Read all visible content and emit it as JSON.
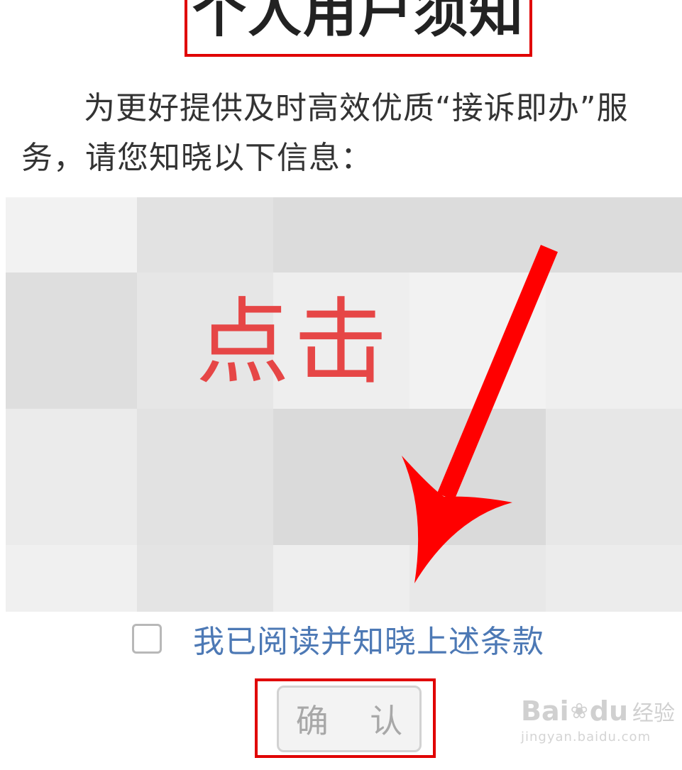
{
  "header": {
    "title": "个人用户须知"
  },
  "notice": {
    "intro": "为更好提供及时高效优质“接诉即办”服务，请您知晓以下信息："
  },
  "annotation": {
    "click_label": "点击",
    "accent_color": "#e00000",
    "label_color": "#e64646"
  },
  "mosaic": {
    "cells": [
      "#f2f2f2",
      "#e2e2e2",
      "#dcdcdc",
      "#dcdcdc",
      "#dcdcdc",
      "#dedede",
      "#e6e6e6",
      "#eeeeee",
      "#f2f2f2",
      "#efefef",
      "#ebebeb",
      "#e2e2e2",
      "#dadada",
      "#dadada",
      "#e7e7e7",
      "#f0f0f0",
      "#e4e4e4",
      "#eeeeee",
      "#e8e8e8",
      "#ececec"
    ]
  },
  "agreement": {
    "checked": false,
    "label": "我已阅读并知晓上述条款",
    "link_color": "#4d79b5"
  },
  "actions": {
    "confirm_label": "确 认",
    "disabled": true
  },
  "watermark": {
    "brand": "Bai",
    "brand_suffix": "du",
    "brand_cn": "经验",
    "url": "jingyan.baidu.com"
  }
}
